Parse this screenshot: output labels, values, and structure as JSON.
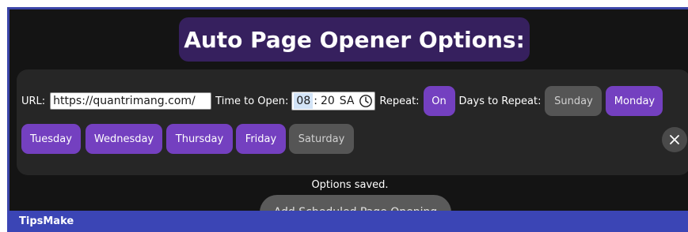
{
  "header": {
    "title": "Auto Page Opener Options:"
  },
  "options": {
    "url_label": "URL:",
    "url_value": "https://quantrimang.com/",
    "time_label": "Time to Open:",
    "time": {
      "hour": "08",
      "minute": "20",
      "period": "SA"
    },
    "repeat_label": "Repeat:",
    "repeat_button": "On",
    "days_label": "Days to Repeat:",
    "days": [
      {
        "label": "Sunday",
        "selected": false
      },
      {
        "label": "Monday",
        "selected": true
      },
      {
        "label": "Tuesday",
        "selected": true
      },
      {
        "label": "Wednesday",
        "selected": true
      },
      {
        "label": "Thursday",
        "selected": true
      },
      {
        "label": "Friday",
        "selected": true
      },
      {
        "label": "Saturday",
        "selected": false
      }
    ],
    "close_icon": "close-icon"
  },
  "status": {
    "text": "Options saved."
  },
  "actions": {
    "add_label": "Add Scheduled Page Opening"
  },
  "footer": {
    "brand": "TipsMake"
  },
  "colors": {
    "frame_bg": "#141414",
    "panel_bg": "#262626",
    "title_bg": "#36205e",
    "accent_selected": "#7440c0",
    "unselected": "#555555",
    "footer_bar": "#3b45b5"
  }
}
